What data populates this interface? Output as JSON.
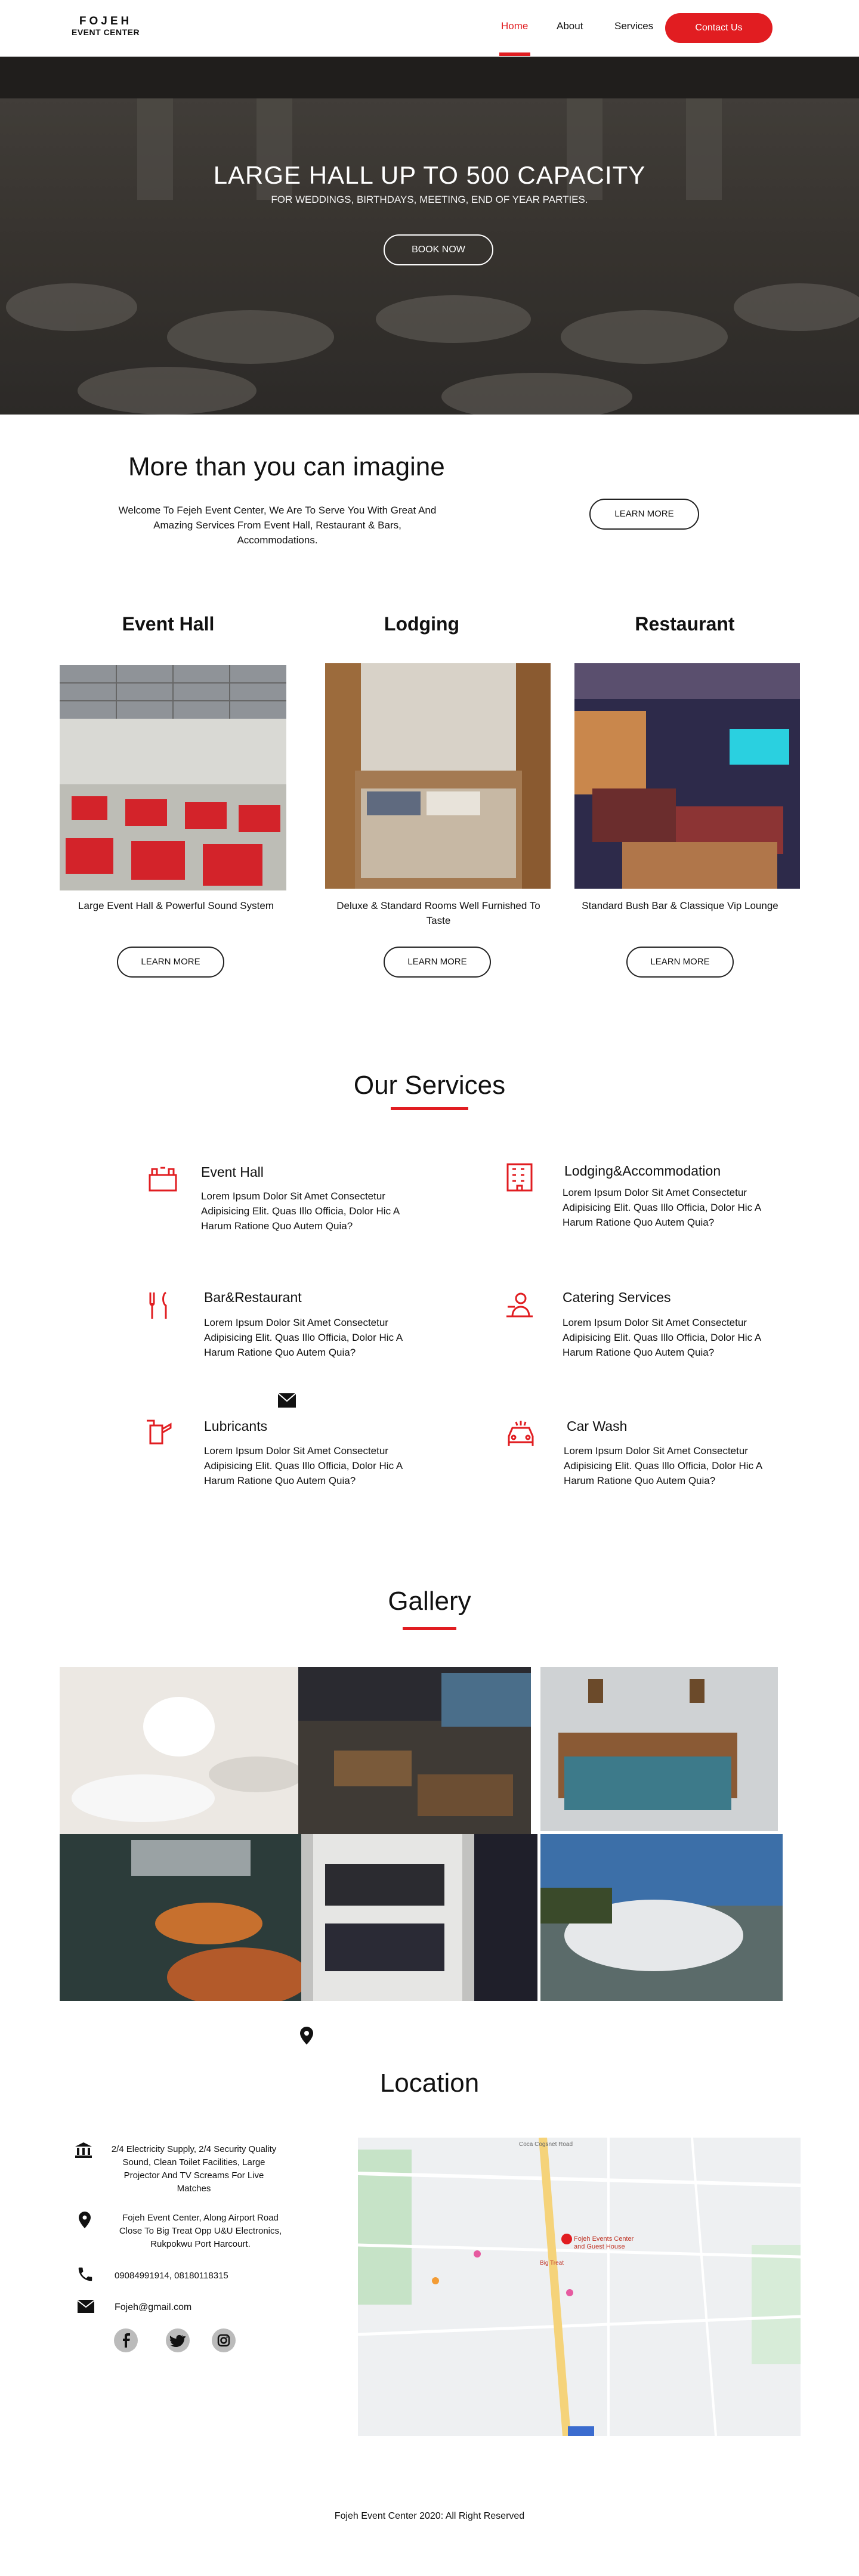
{
  "nav": {
    "logo_line1": "FOJEH",
    "logo_line2": "EVENT CENTER",
    "links": [
      "Home",
      "About",
      "Services"
    ],
    "contact": "Contact Us"
  },
  "hero": {
    "title": "LARGE HALL UP TO 500 CAPACITY",
    "subtitle": "FOR WEDDINGS, BIRTHDAYS, MEETING, END OF YEAR PARTIES.",
    "button": "BOOK NOW"
  },
  "intro": {
    "title": "More than you can imagine",
    "text": "Welcome To Fejeh Event Center, We Are To Serve You With Great And Amazing Services From Event Hall, Restaurant & Bars, Accommodations.",
    "button": "LEARN MORE"
  },
  "categories": [
    {
      "title": "Event Hall",
      "caption": "Large Event Hall & Powerful Sound System",
      "button": "LEARN MORE"
    },
    {
      "title": "Lodging",
      "caption": "Deluxe & Standard Rooms Well Furnished To Taste",
      "button": "LEARN MORE"
    },
    {
      "title": "Restaurant",
      "caption": "Standard Bush Bar & Classique Vip Lounge",
      "button": "LEARN MORE"
    }
  ],
  "services": {
    "heading": "Our Services",
    "items": [
      {
        "name": "Event Hall",
        "desc": "Lorem Ipsum Dolor Sit Amet Consectetur Adipisicing Elit. Quas Illo Officia, Dolor Hic A Harum Ratione Quo Autem Quia?"
      },
      {
        "name": "Lodging&Accommodation",
        "desc": "Lorem Ipsum Dolor Sit Amet Consectetur Adipisicing Elit. Quas Illo Officia, Dolor Hic A Harum Ratione Quo Autem Quia?"
      },
      {
        "name": "Bar&Restaurant",
        "desc": "Lorem Ipsum Dolor Sit Amet Consectetur Adipisicing Elit. Quas Illo Officia, Dolor Hic A Harum Ratione Quo Autem Quia?"
      },
      {
        "name": "Catering Services",
        "desc": "Lorem Ipsum Dolor Sit Amet Consectetur Adipisicing Elit. Quas Illo Officia, Dolor Hic A Harum Ratione Quo Autem Quia?"
      },
      {
        "name": "Lubricants",
        "desc": "Lorem Ipsum Dolor Sit Amet Consectetur Adipisicing Elit. Quas Illo Officia, Dolor Hic A Harum Ratione Quo Autem Quia?"
      },
      {
        "name": "Car Wash",
        "desc": "Lorem Ipsum Dolor Sit Amet Consectetur Adipisicing Elit. Quas Illo Officia, Dolor Hic A Harum Ratione Quo Autem Quia?"
      }
    ]
  },
  "gallery": {
    "heading": "Gallery"
  },
  "location": {
    "heading": "Location",
    "amenities": "2/4 Electricity Supply, 2/4 Security Quality Sound, Clean Toilet Facilities, Large Projector And TV Screams For Live Matches",
    "address": "Fojeh Event Center, Along Airport Road Close To Big Treat Opp U&U Electronics, Rukpokwu Port Harcourt.",
    "phone": "09084991914, 08180118315",
    "email": "Fojeh@gmail.com",
    "map_labels": {
      "venue": "Fojeh Events Center and Guest House",
      "road": "Coca Cogsnet Road",
      "shop": "Big Treat"
    }
  },
  "footer": {
    "text": "Fojeh Event Center 2020: All Right Reserved"
  },
  "colors": {
    "accent": "#e11d21",
    "text": "#111111",
    "background": "#ffffff"
  },
  "icons": [
    "phone-icon",
    "mail-icon",
    "map-pin-icon",
    "bank-icon",
    "facebook-icon",
    "twitter-icon",
    "instagram-icon"
  ]
}
